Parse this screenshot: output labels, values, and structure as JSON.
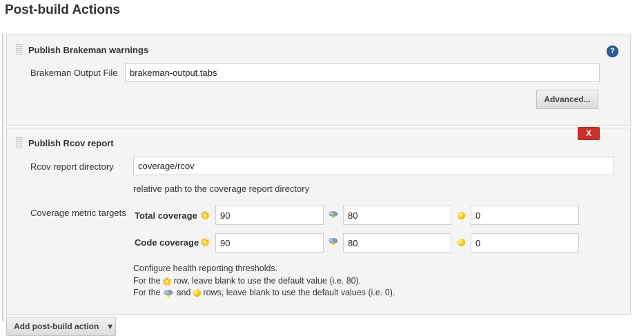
{
  "page": {
    "title": "Post-build Actions"
  },
  "brakeman": {
    "title": "Publish Brakeman warnings",
    "output_file_label": "Brakeman Output File",
    "output_file_value": "brakeman-output.tabs",
    "advanced_button": "Advanced...",
    "help_icon": "?"
  },
  "rcov": {
    "delete_button": "X",
    "title": "Publish Rcov report",
    "dir_label": "Rcov report directory",
    "dir_value": "coverage/rcov",
    "dir_hint": "relative path to the coverage report directory",
    "targets_label": "Coverage metric targets",
    "rows": [
      {
        "label": "Total coverage",
        "healthy": "90",
        "unhealthy": "80",
        "unstable": "0"
      },
      {
        "label": "Code coverage",
        "healthy": "90",
        "unhealthy": "80",
        "unstable": "0"
      }
    ],
    "help_lines": {
      "line1": "Configure health reporting thresholds.",
      "line2_pre": "For the",
      "line2_post": "row, leave blank to use the default value (i.e. 80).",
      "line3_pre": "For the",
      "line3_mid": "and",
      "line3_post": "rows, leave blank to use the default values (i.e. 0)."
    }
  },
  "footer": {
    "add_button": "Add post-build action",
    "dropdown_arrow": "▾"
  },
  "icons": {
    "healthy": "sun-icon",
    "unhealthy": "storm-cloud-icon",
    "unstable": "yellow-ball-icon",
    "help": "help-icon",
    "drag": "drag-handle-icon"
  },
  "colors": {
    "delete": "#c9302c",
    "help": "#2c5e9e",
    "section_bg": "#f4f4f4"
  }
}
